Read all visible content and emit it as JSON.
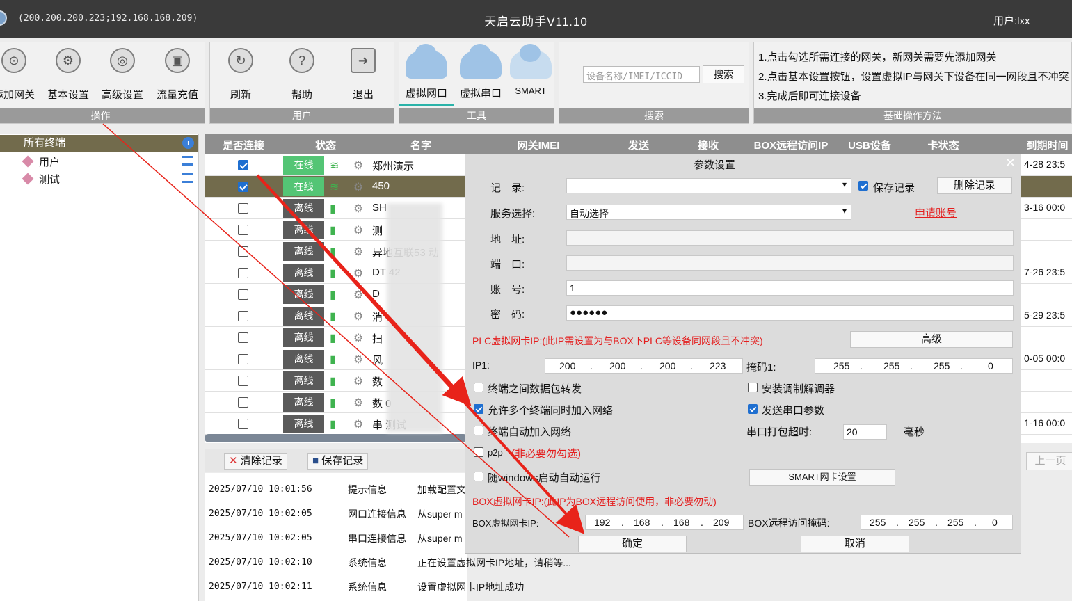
{
  "window": {
    "ip_info": "(200.200.200.223;192.168.168.209)",
    "title": "天启云助手V11.10",
    "user": "用户:lxx"
  },
  "toolbar": {
    "ops": {
      "items": [
        "添加网关",
        "基本设置",
        "高级设置",
        "流量充值"
      ],
      "footer": "操作"
    },
    "user": {
      "items": [
        "刷新",
        "帮助",
        "退出"
      ],
      "footer": "用户"
    },
    "tools": {
      "items": [
        "虚拟网口",
        "虚拟串口",
        "SMART"
      ],
      "footer": "工具"
    },
    "search": {
      "placeholder": "设备名称/IMEI/ICCID",
      "button": "搜索",
      "footer": "搜索"
    },
    "help": {
      "lines": [
        "1.点击勾选所需连接的网关，新网关需要先添加网关",
        "2.点击基本设置按钮，设置虚拟IP与网关下设备在同一网段且不冲突",
        "3.完成后即可连接设备"
      ],
      "footer": "基础操作方法"
    }
  },
  "tree": {
    "root": "所有终端",
    "items": [
      "用户",
      "测试"
    ]
  },
  "grid": {
    "headers": [
      "是否连接",
      "状态",
      "名字",
      "网关IMEI",
      "发送",
      "接收",
      "BOX远程访问IP",
      "USB设备",
      "卡状态",
      "到期时间"
    ],
    "rows": [
      {
        "connected": true,
        "status": "在线",
        "name": "郑州演示",
        "expiry": "4-28 23:5"
      },
      {
        "connected": true,
        "status": "在线",
        "name": "450",
        "expiry": ""
      },
      {
        "connected": false,
        "status": "离线",
        "name": "SH",
        "expiry": "3-16 00:0"
      },
      {
        "connected": false,
        "status": "离线",
        "name": "测",
        "expiry": ""
      },
      {
        "connected": false,
        "status": "离线",
        "name": "异地互联53 动",
        "expiry": ""
      },
      {
        "connected": false,
        "status": "离线",
        "name": "DT  42",
        "expiry": "7-26 23:5"
      },
      {
        "connected": false,
        "status": "离线",
        "name": "D",
        "expiry": ""
      },
      {
        "connected": false,
        "status": "离线",
        "name": "消",
        "expiry": "5-29 23:5"
      },
      {
        "connected": false,
        "status": "离线",
        "name": "扫",
        "expiry": ""
      },
      {
        "connected": false,
        "status": "离线",
        "name": "风",
        "expiry": "0-05 00:0"
      },
      {
        "connected": false,
        "status": "离线",
        "name": "数",
        "expiry": ""
      },
      {
        "connected": false,
        "status": "离线",
        "name": "数   0",
        "expiry": ""
      },
      {
        "connected": false,
        "status": "离线",
        "name": "串   测试",
        "expiry": "1-16 00:0"
      }
    ]
  },
  "log": {
    "clear_btn": "清除记录",
    "save_btn": "保存记录",
    "rows": [
      {
        "time": "2025/07/10 10:01:56",
        "type": "提示信息",
        "msg": "加载配置文"
      },
      {
        "time": "2025/07/10 10:02:05",
        "type": "网口连接信息",
        "msg": "从super m"
      },
      {
        "time": "2025/07/10 10:02:05",
        "type": "串口连接信息",
        "msg": "从super m"
      },
      {
        "time": "2025/07/10 10:02:10",
        "type": "系统信息",
        "msg": "正在设置虚拟网卡IP地址，请稍等..."
      },
      {
        "time": "2025/07/10 10:02:11",
        "type": "系统信息",
        "msg": "设置虚拟网卡IP地址成功"
      }
    ]
  },
  "pager": {
    "prev": "上一页"
  },
  "dialog": {
    "title": "参数设置",
    "record_label": "记　录:",
    "save_record": "保存记录",
    "delete_record": "删除记录",
    "service_label": "服务选择:",
    "service_value": "自动选择",
    "apply_account": "申请账号",
    "address_label": "地　址:",
    "port_label": "端　口:",
    "account_label": "账　号:",
    "account_value": "1",
    "password_label": "密　码:",
    "password_value": "●●●●●●",
    "plc_note": "PLC虚拟网卡IP:(此IP需设置为与BOX下PLC等设备同网段且不冲突)",
    "advanced_btn": "高级",
    "ip1_label": "IP1:",
    "ip1": [
      "200",
      "200",
      "200",
      "223"
    ],
    "mask1_label": "掩码1:",
    "mask1": [
      "255",
      "255",
      "255",
      "0"
    ],
    "opt_forward": "终端之间数据包转发",
    "opt_multi": "允许多个终端同时加入网络",
    "opt_auto": "终端自动加入网络",
    "opt_p2p": "p2p",
    "p2p_note": "(非必要勿勾选)",
    "opt_startup": "随windows启动自动运行",
    "opt_modem": "安装调制解调器",
    "opt_serial": "发送串口参数",
    "serial_timeout_label": "串口打包超时:",
    "serial_timeout": "20",
    "ms": "毫秒",
    "smart_btn": "SMART网卡设置",
    "box_note": "BOX虚拟网卡IP:(此IP为BOX远程访问使用，非必要勿动)",
    "box_ip_label": "BOX虚拟网卡IP:",
    "box_ip": [
      "192",
      "168",
      "168",
      "209"
    ],
    "box_mask_label": "BOX远程访问掩码:",
    "box_mask": [
      "255",
      "255",
      "255",
      "0"
    ],
    "ok": "确定",
    "cancel": "取消"
  }
}
